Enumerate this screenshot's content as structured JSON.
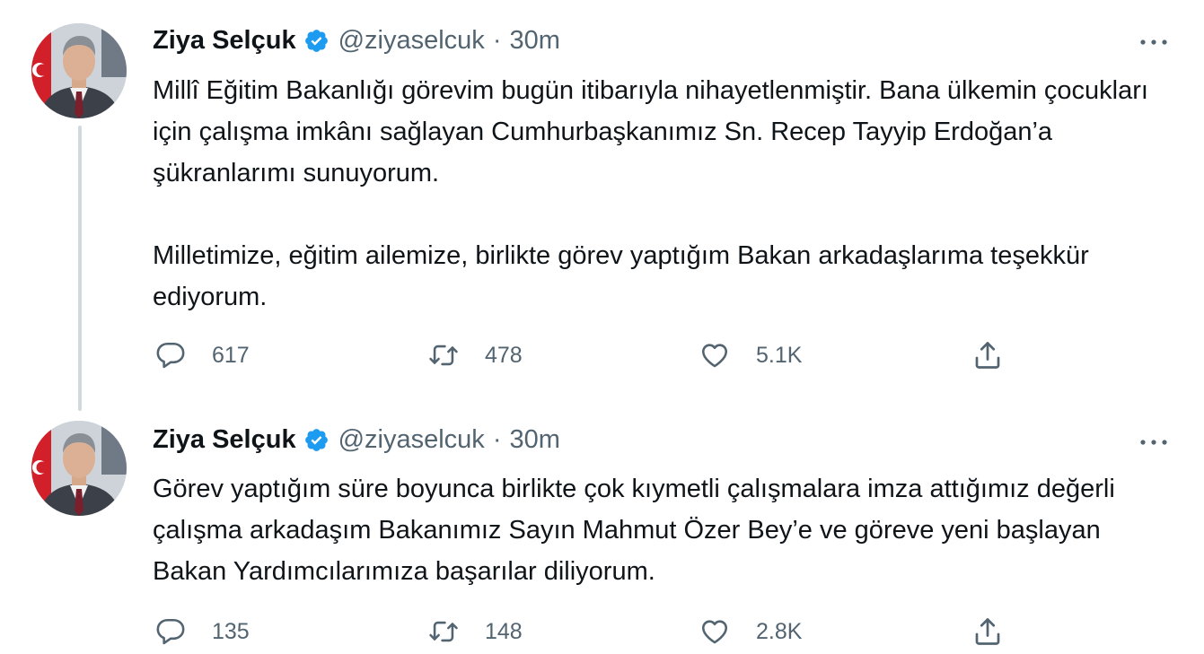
{
  "tweets": [
    {
      "author": {
        "name": "Ziya Selçuk",
        "handle": "@ziyaselcuk"
      },
      "separator": "·",
      "time": "30m",
      "paragraphs": [
        "Millî Eğitim Bakanlığı görevim bugün itibarıyla nihayetlenmiştir. Bana ülkemin çocukları için çalışma imkânı sağlayan Cumhurbaşkanımız Sn. Recep Tayyip Erdoğan’a şükranlarımı sunuyorum.",
        "Milletimize, eğitim ailemize, birlikte görev yaptığım Bakan arkadaşlarıma teşekkür ediyorum."
      ],
      "stats": {
        "replies": "617",
        "retweets": "478",
        "likes": "5.1K"
      }
    },
    {
      "author": {
        "name": "Ziya Selçuk",
        "handle": "@ziyaselcuk"
      },
      "separator": "·",
      "time": "30m",
      "paragraphs": [
        "Görev yaptığım süre boyunca birlikte çok kıymetli çalışmalara imza attığımız değerli çalışma arkadaşım Bakanımız Sayın Mahmut Özer Bey’e ve göreve yeni başlayan Bakan Yardımcılarımıza  başarılar diliyorum."
      ],
      "stats": {
        "replies": "135",
        "retweets": "148",
        "likes": "2.8K"
      }
    }
  ],
  "icons": {
    "verified": "verified-badge-icon",
    "more": "more-dots-icon",
    "reply": "reply-bubble-icon",
    "retweet": "retweet-arrows-icon",
    "like": "heart-icon",
    "share": "share-upload-icon"
  },
  "colors": {
    "accent": "#1d9bf0",
    "text": "#0f1419",
    "muted": "#536471",
    "thread_line": "#cfd9de"
  }
}
